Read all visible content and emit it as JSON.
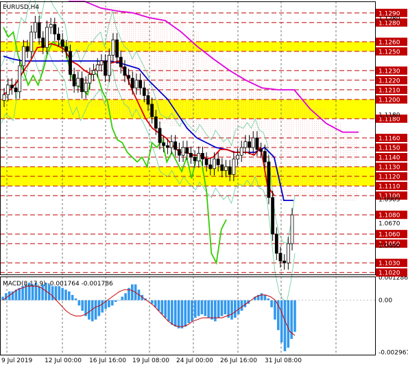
{
  "chart_data": [
    {
      "type": "candlestick",
      "title": "EURUSD,H4",
      "x_tick_labels": [
        "9 Jul 2019",
        "12 Jul 00:00",
        "16 Jul 16:00",
        "19 Jul 08:00",
        "24 Jul 00:00",
        "26 Jul 16:00",
        "31 Jul 08:00"
      ],
      "y_range": [
        1.1018,
        1.1302
      ],
      "price_levels": [
        1.129,
        1.128,
        1.126,
        1.125,
        1.123,
        1.122,
        1.121,
        1.12,
        1.118,
        1.116,
        1.115,
        1.114,
        1.113,
        1.112,
        1.111,
        1.11,
        1.108,
        1.106,
        1.105,
        1.103,
        1.102
      ],
      "price_labels_plain": [
        "1.1280",
        "1.1180",
        "1.0905",
        "1.0670",
        "1.0440"
      ],
      "current_price": "1.1080",
      "highlight_zones": [
        [
          1.118,
          1.12
        ],
        [
          1.125,
          1.126
        ],
        [
          1.111,
          1.113
        ]
      ],
      "colors": {
        "zones": "#ffff00",
        "levels": "#c00000",
        "price_tag": "#c00000",
        "kijun": "#0000cc",
        "tenkan": "#dd0000",
        "chikou": "#33cc00",
        "senkou_b": "#dd00dd",
        "bollinger": "#66cc99",
        "candles": "#000000"
      },
      "series": [
        {
          "values": [
            1.1205,
            1.1215,
            1.1212,
            1.1208,
            1.1235,
            1.1255,
            1.125,
            1.127,
            1.128,
            1.1264,
            1.1254,
            1.1275,
            1.1278,
            1.1268,
            1.1262,
            1.1255,
            1.125,
            1.1226,
            1.1214,
            1.1222,
            1.1208,
            1.1217,
            1.1226,
            1.123,
            1.1236,
            1.124,
            1.1225,
            1.1246,
            1.1262,
            1.1244,
            1.1234,
            1.1225,
            1.1222,
            1.1212,
            1.122,
            1.1212,
            1.1204,
            1.1195,
            1.1182,
            1.117,
            1.1155,
            1.1152,
            1.115,
            1.1156,
            1.1148,
            1.1142,
            1.115,
            1.1144,
            1.114,
            1.1136,
            1.1144,
            1.1138,
            1.1132,
            1.1128,
            1.1138,
            1.1132,
            1.1126,
            1.113,
            1.1122,
            1.1138,
            1.1142,
            1.115,
            1.1156,
            1.115,
            1.116,
            1.1148,
            1.1146,
            1.1135,
            1.1098,
            1.106,
            1.104,
            1.1032,
            1.103,
            1.105,
            1.108
          ]
        },
        {
          "name": "Tenkan",
          "values": [
            1.1205,
            1.121,
            1.1218,
            1.123,
            1.124,
            1.1254,
            1.1255,
            1.1258,
            1.1256,
            1.1252,
            1.124,
            1.1236,
            1.123,
            1.1226,
            1.1235,
            1.124,
            1.1238,
            1.124,
            1.1228,
            1.121,
            1.1195,
            1.118,
            1.117,
            1.1165,
            1.116,
            1.1152,
            1.1145,
            1.1145,
            1.1142,
            1.1142,
            1.1138,
            1.114,
            1.1148,
            1.1148,
            1.1145,
            1.1145,
            1.1145,
            1.1142,
            1.115,
            1.111,
            1.11
          ]
        },
        {
          "name": "Kijun",
          "values": [
            1.1245,
            1.1242,
            1.124,
            1.124,
            1.124,
            1.124,
            1.124,
            1.124,
            1.124,
            1.124,
            1.124,
            1.124,
            1.1238,
            1.1235,
            1.1232,
            1.122,
            1.121,
            1.12,
            1.1185,
            1.117,
            1.116,
            1.1155,
            1.115,
            1.1148,
            1.1145,
            1.1145,
            1.1145,
            1.115,
            1.114,
            1.1095,
            1.1095
          ]
        },
        {
          "name": "Chikou",
          "values": [
            1.1275,
            1.1265,
            1.127,
            1.1245,
            1.123,
            1.1215,
            1.1225,
            1.1215,
            1.123,
            1.125,
            1.126,
            1.1255,
            1.1262,
            1.124,
            1.122,
            1.1215,
            1.121,
            1.1205,
            1.123,
            1.1225,
            1.1208,
            1.1198,
            1.117,
            1.1158,
            1.1155,
            1.1145,
            1.114,
            1.1135,
            1.114,
            1.113,
            1.1155,
            1.115,
            1.1158,
            1.1135,
            1.1145,
            1.1135,
            1.1125,
            1.114,
            1.1118,
            1.114,
            1.1135,
            1.1105,
            1.104,
            1.103,
            1.1065,
            1.1075
          ]
        },
        {
          "name": "Senkou B",
          "values": [
            1.1302,
            1.1302,
            1.1295,
            1.1292,
            1.129,
            1.1285,
            1.1282,
            1.127,
            1.1255,
            1.1242,
            1.123,
            1.122,
            1.1212,
            1.121,
            1.121,
            1.119,
            1.1175,
            1.1166,
            1.1166
          ]
        }
      ]
    },
    {
      "type": "bar",
      "title": "MACD(8,17,9) -0.001764 -0.001786",
      "y_tick_labels": [
        "0.001286",
        "0.00",
        "-0.002967"
      ],
      "ylim": [
        -0.0031,
        0.00135
      ],
      "series": [
        {
          "name": "MACD",
          "values": [
            0.0002,
            0.0004,
            0.0005,
            0.0005,
            0.0006,
            0.0007,
            0.0008,
            0.0009,
            0.001,
            0.0009,
            0.001,
            0.0008,
            0.0009,
            0.001,
            0.0009,
            0.0008,
            0.0008,
            0.0008,
            0.0007,
            0.0006,
            0.0005,
            0.0003,
            0.0001,
            -0.0003,
            -0.0006,
            -0.0009,
            -0.0011,
            -0.0012,
            -0.0011,
            -0.0009,
            -0.0007,
            -0.0005,
            -0.0004,
            -0.0003,
            -0.0001,
            0.0,
            0.0002,
            0.0004,
            0.0007,
            0.0009,
            0.0009,
            0.0006,
            0.0003,
            0.0001,
            0.0,
            -0.0002,
            -0.0004,
            -0.0006,
            -0.0008,
            -0.001,
            -0.0012,
            -0.0014,
            -0.0015,
            -0.0016,
            -0.0016,
            -0.0015,
            -0.0013,
            -0.0012,
            -0.001,
            -0.0009,
            -0.0008,
            -0.0009,
            -0.001,
            -0.0011,
            -0.0012,
            -0.001,
            -0.0009,
            -0.0008,
            -0.001,
            -0.0011,
            -0.001,
            -0.0008,
            -0.0006,
            -0.0004,
            -0.0002,
            0.0,
            0.0002,
            0.0003,
            0.0004,
            0.0003,
            0.0001,
            -0.0004,
            -0.0011,
            -0.0017,
            -0.0024,
            -0.0029,
            -0.0027,
            -0.0022,
            -0.0018
          ]
        },
        {
          "name": "Signal",
          "values": [
            0.0,
            0.0002,
            0.0004,
            0.0006,
            0.0007,
            0.0008,
            0.0008,
            0.0008,
            0.0007,
            0.0005,
            0.0003,
            0.0,
            -0.0003,
            -0.0006,
            -0.0008,
            -0.0009,
            -0.0009,
            -0.0008,
            -0.0006,
            -0.0004,
            -0.0003,
            -0.0001,
            0.0001,
            0.0003,
            0.0005,
            0.0006,
            0.0006,
            0.0005,
            0.0003,
            0.0001,
            -0.0001,
            -0.0003,
            -0.0006,
            -0.0009,
            -0.0012,
            -0.0014,
            -0.0015,
            -0.0015,
            -0.0014,
            -0.0012,
            -0.0011,
            -0.001,
            -0.001,
            -0.001,
            -0.001,
            -0.001,
            -0.0009,
            -0.0008,
            -0.0006,
            -0.0004,
            -0.0002,
            0.0,
            0.0002,
            0.0003,
            0.0003,
            0.0002,
            0.0,
            -0.0005,
            -0.0012,
            -0.0018,
            -0.002
          ]
        }
      ]
    }
  ]
}
